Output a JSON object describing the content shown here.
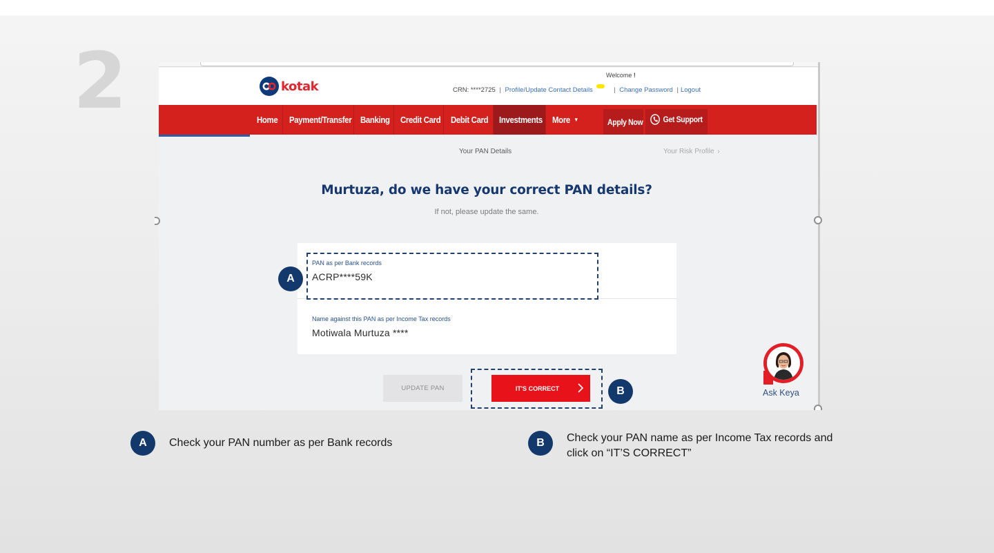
{
  "slide": {
    "step_number": "2"
  },
  "header": {
    "logo_text": "kotak",
    "welcome_label": "Welcome",
    "welcome_name": "!",
    "crn_text": "CRN: ****2725",
    "profile_link": "Profile/Update Contact Details",
    "change_password_link": "Change Password",
    "logout_link": "Logout"
  },
  "nav": {
    "items": [
      "Home",
      "Payment/Transfer",
      "Banking",
      "Credit Card",
      "Debit Card",
      "Investments",
      "More"
    ],
    "active_item": "Investments",
    "apply_now": "Apply Now",
    "get_support": "Get Support"
  },
  "steps": {
    "current": "Your PAN Details",
    "next": "Your Risk Profile"
  },
  "main": {
    "question": "Murtuza, do we have your correct PAN details?",
    "subtext": "If not, please update the same."
  },
  "pan_card": {
    "pan_label": "PAN as per Bank records",
    "pan_value": "ACRP****59K",
    "name_label": "Name against this PAN as per Income Tax records",
    "name_value": "Motiwala Murtuza ****"
  },
  "buttons": {
    "update_pan": "UPDATE PAN",
    "its_correct": "IT'S CORRECT"
  },
  "chatbot": {
    "label": "Ask Keya"
  },
  "annotations": {
    "a_marker": "A",
    "b_marker": "B",
    "a_caption": "Check your PAN number as per Bank records",
    "b_caption_line1": "Check your PAN name as per Income Tax records and",
    "b_caption_line2": "click on “IT’S CORRECT”"
  },
  "colors": {
    "brand_red": "#d4211d",
    "active_nav": "#9c1a1c",
    "brand_blue": "#0d3a78",
    "heading_blue": "#16386e",
    "badge_navy": "#13386b",
    "cta_red": "#e8131a"
  }
}
